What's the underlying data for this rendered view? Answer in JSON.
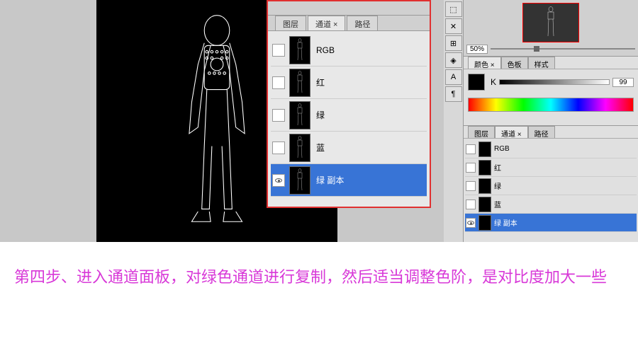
{
  "panel": {
    "tabs": {
      "layers": "图层",
      "channels": "通道 ×",
      "paths": "路径"
    },
    "channels": [
      {
        "name": "RGB",
        "visible": false,
        "selected": false
      },
      {
        "name": "红",
        "visible": false,
        "selected": false
      },
      {
        "name": "绿",
        "visible": false,
        "selected": false
      },
      {
        "name": "蓝",
        "visible": false,
        "selected": false
      },
      {
        "name": "绿 副本",
        "visible": true,
        "selected": true
      }
    ]
  },
  "navigator": {
    "zoom": "50%"
  },
  "color_panel": {
    "tabs": {
      "color": "颜色 ×",
      "swatches": "色板",
      "styles": "样式"
    },
    "label": "K",
    "value": "99"
  },
  "small_panel": {
    "tabs": {
      "layers": "图层",
      "channels": "通道 ×",
      "paths": "路径"
    },
    "items": [
      {
        "name": "RGB",
        "visible": false,
        "selected": false
      },
      {
        "name": "红",
        "visible": false,
        "selected": false
      },
      {
        "name": "绿",
        "visible": false,
        "selected": false
      },
      {
        "name": "蓝",
        "visible": false,
        "selected": false
      },
      {
        "name": "绿 副本",
        "visible": true,
        "selected": true
      }
    ]
  },
  "caption": "第四步、进入通道面板，对绿色通道进行复制，然后适当调整色阶，是对比度加大一些"
}
